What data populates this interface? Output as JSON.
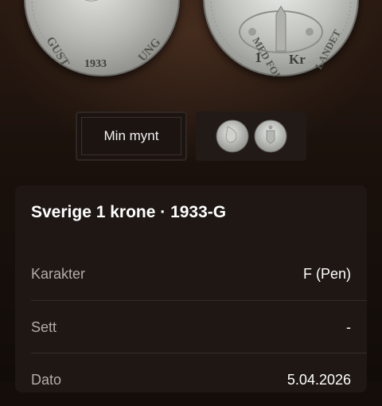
{
  "coin_images": {
    "obverse_legend_left": "GUST",
    "obverse_legend_right": "UNG",
    "obverse_year": "1933",
    "reverse_legend_left": "MED FOL",
    "reverse_legend_right": "LANDET",
    "reverse_denomination": "1",
    "reverse_unit": "Kr"
  },
  "toggle": {
    "my_coin_label": "Min mynt"
  },
  "card": {
    "title": "Sverige 1 krone · 1933-G",
    "rows": [
      {
        "label": "Karakter",
        "value": "F (Pen)"
      },
      {
        "label": "Sett",
        "value": "-"
      },
      {
        "label": "Dato",
        "value": "5.04.2026"
      }
    ]
  },
  "colors": {
    "background": "#140d0a",
    "card": "#1e1713",
    "label_text": "#b3aca8",
    "coin_silver": "#c9cac6"
  }
}
